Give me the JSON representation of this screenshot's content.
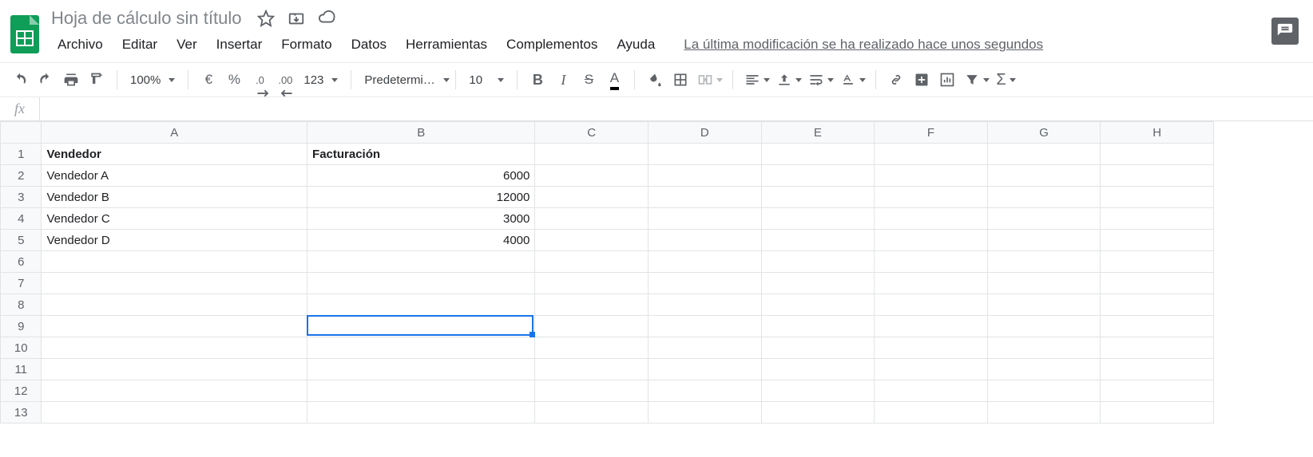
{
  "doc": {
    "title": "Hoja de cálculo sin título"
  },
  "menu": {
    "items": [
      "Archivo",
      "Editar",
      "Ver",
      "Insertar",
      "Formato",
      "Datos",
      "Herramientas",
      "Complementos",
      "Ayuda"
    ],
    "last_edit": "La última modificación se ha realizado hace unos segundos"
  },
  "toolbar": {
    "zoom": "100%",
    "currency": "€",
    "percent": "%",
    "dec_less": ".0",
    "dec_more": ".00",
    "numfmt": "123",
    "font": "Predetermi…",
    "font_size": "10"
  },
  "formula_bar": {
    "fx": "fx",
    "value": ""
  },
  "columns": [
    "A",
    "B",
    "C",
    "D",
    "E",
    "F",
    "G",
    "H"
  ],
  "rows": [
    1,
    2,
    3,
    4,
    5,
    6,
    7,
    8,
    9,
    10,
    11,
    12,
    13
  ],
  "cells": {
    "A1": "Vendedor",
    "B1": "Facturación",
    "A2": "Vendedor A",
    "B2": "6000",
    "A3": "Vendedor B",
    "B3": "12000",
    "A4": "Vendedor C",
    "B4": "3000",
    "A5": "Vendedor D",
    "B5": "4000"
  },
  "selection": {
    "col": "B",
    "row": 9
  },
  "chart_data": {
    "type": "table",
    "columns": [
      "Vendedor",
      "Facturación"
    ],
    "rows": [
      [
        "Vendedor A",
        6000
      ],
      [
        "Vendedor B",
        12000
      ],
      [
        "Vendedor C",
        3000
      ],
      [
        "Vendedor D",
        4000
      ]
    ]
  }
}
